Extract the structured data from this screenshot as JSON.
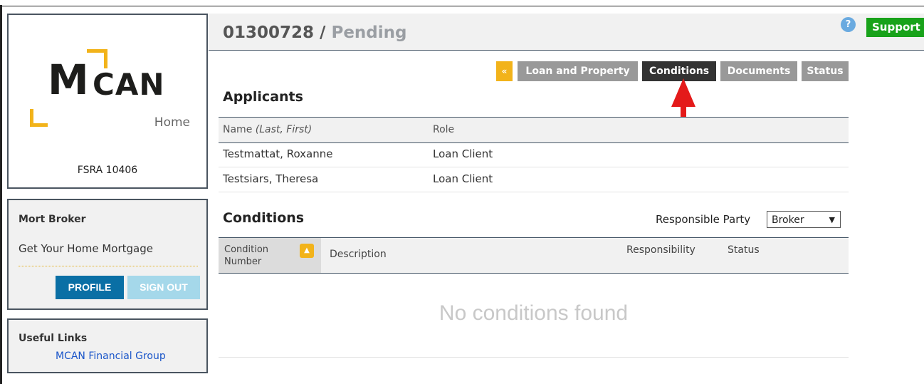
{
  "header": {
    "loan_number": "01300728",
    "separator": "/",
    "status": "Pending",
    "help_icon": "help-icon",
    "support_label": "Support"
  },
  "sidebar": {
    "logo": {
      "brand_m": "M",
      "brand_can": "CAN",
      "brand_sub": "Home",
      "accent_color": "#f2b31a"
    },
    "fsra": "FSRA 10406",
    "broker": {
      "name": "Mort Broker",
      "tagline": "Get Your Home Mortgage",
      "profile_label": "PROFILE",
      "signout_label": "SIGN OUT"
    },
    "useful_links": {
      "title": "Useful Links",
      "items": [
        "MCAN Financial Group"
      ]
    }
  },
  "tabs": {
    "back": "«",
    "items": [
      "Loan and Property",
      "Conditions",
      "Documents",
      "Status"
    ],
    "active": "Conditions"
  },
  "applicants": {
    "title": "Applicants",
    "columns": {
      "name": "Name",
      "name_hint": "(Last, First)",
      "role": "Role"
    },
    "rows": [
      {
        "name": "Testmattat, Roxanne",
        "role": "Loan Client"
      },
      {
        "name": "Testsiars, Theresa",
        "role": "Loan Client"
      }
    ]
  },
  "conditions": {
    "title": "Conditions",
    "responsible_party_label": "Responsible Party",
    "responsible_party_value": "Broker",
    "columns": {
      "number_line1": "Condition",
      "number_line2": "Number",
      "description": "Description",
      "responsibility": "Responsibility",
      "status": "Status"
    },
    "empty_message": "No conditions found"
  },
  "colors": {
    "accent_yellow": "#f2b31a",
    "support_green": "#18a21a",
    "profile_blue": "#0a6fa5",
    "annotation_red": "#e41a1a"
  }
}
